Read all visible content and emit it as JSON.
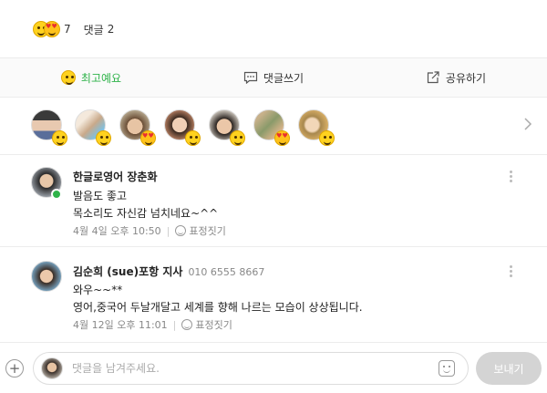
{
  "summary": {
    "reaction_icons": [
      "smile-emoji-icon",
      "love-emoji-icon"
    ],
    "reaction_count": "7",
    "comment_label": "댓글",
    "comment_count": "2"
  },
  "actions": [
    {
      "label": "최고예요",
      "icon": "smile-emoji-icon",
      "active": true
    },
    {
      "label": "댓글쓰기",
      "icon": "comment-bubble-icon",
      "active": false
    },
    {
      "label": "공유하기",
      "icon": "share-icon",
      "active": false
    }
  ],
  "reactors": [
    {
      "reaction": "smile"
    },
    {
      "reaction": "smile"
    },
    {
      "reaction": "love"
    },
    {
      "reaction": "smile"
    },
    {
      "reaction": "smile"
    },
    {
      "reaction": "love"
    },
    {
      "reaction": "smile"
    }
  ],
  "comments": [
    {
      "name": "한글로영어 장춘화",
      "phone": "",
      "lines": [
        "발음도 좋고",
        "목소리도 자신감 넘치네요~^^"
      ],
      "time": "4월 4일 오후 10:50",
      "react_label": "표정짓기",
      "has_badge": true
    },
    {
      "name": "김순희 (sue)포항 지사",
      "phone": "010 6555 8667",
      "lines": [
        "와우~~**",
        "영어,중국어 두날개달고 세계를 향해 나르는 모습이 상상됩니다."
      ],
      "time": "4월 12일 오후 11:01",
      "react_label": "표정짓기",
      "has_badge": false
    }
  ],
  "input": {
    "placeholder": "댓글을 남겨주세요.",
    "send_label": "보내기"
  },
  "colors": {
    "accent": "#2fb34a",
    "send_disabled": "#d4d4d4",
    "divider": "#ececec"
  }
}
